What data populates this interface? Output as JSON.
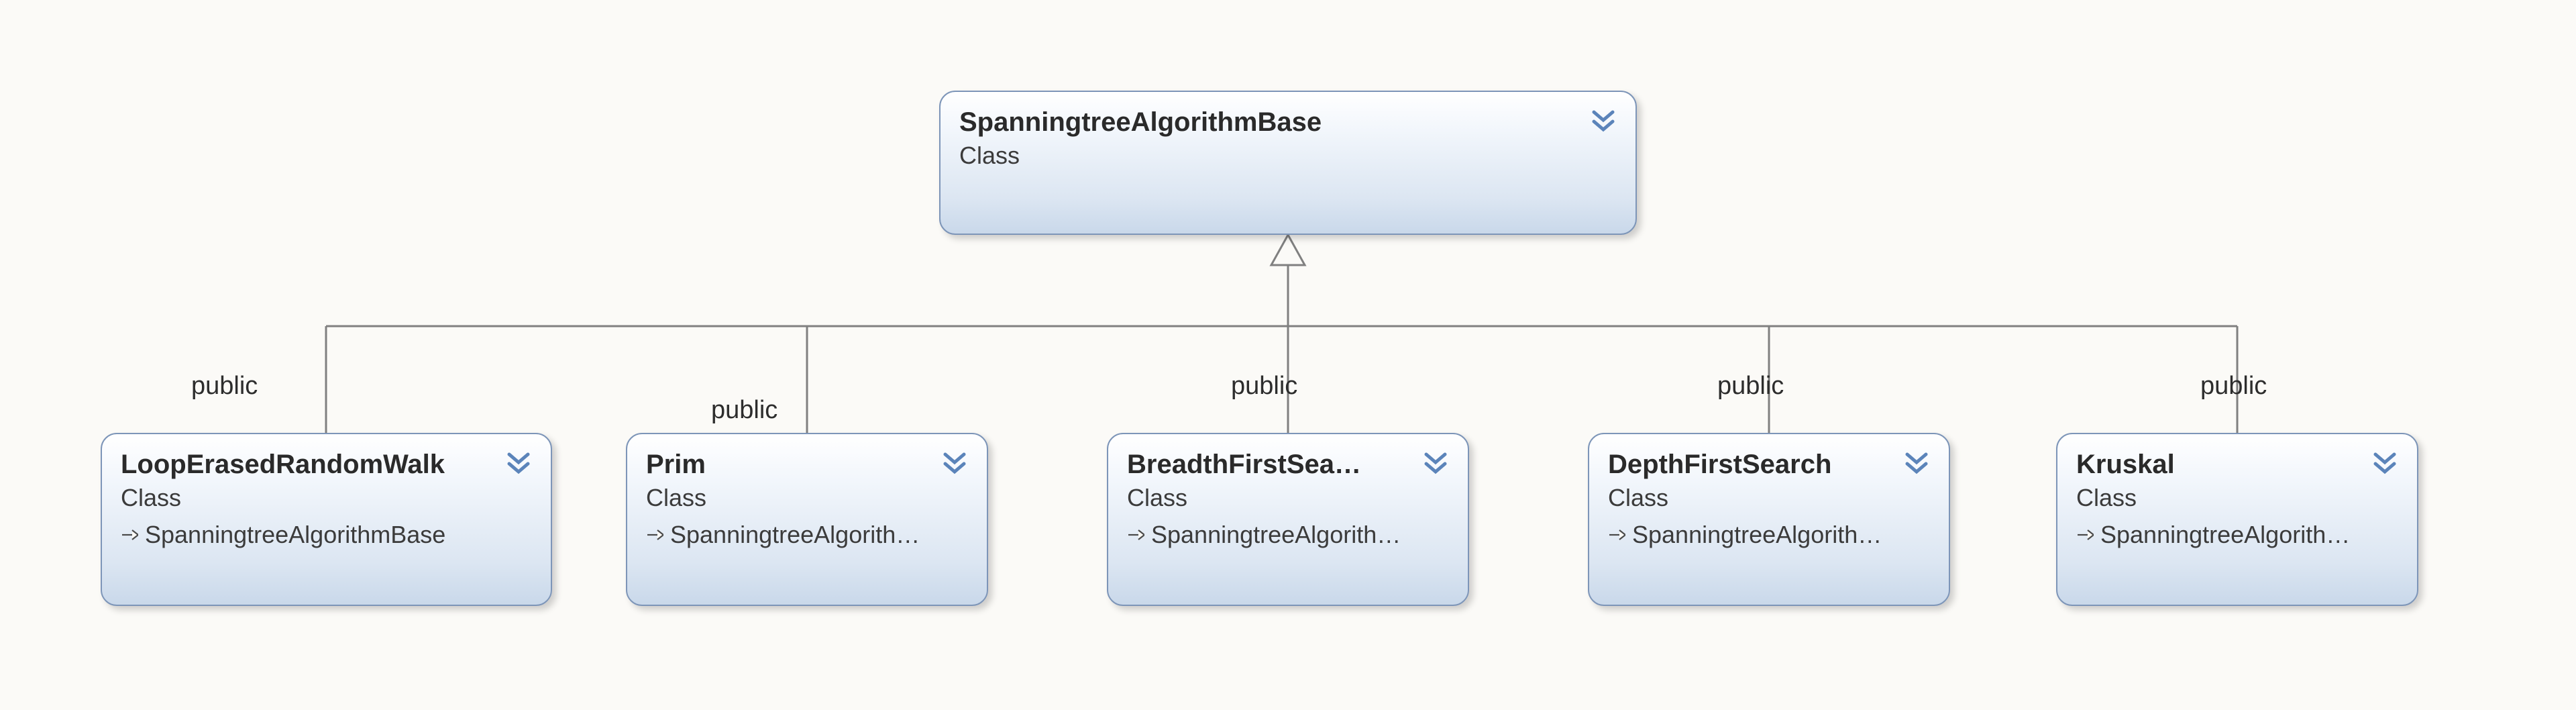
{
  "diagram": {
    "base": {
      "name": "SpanningtreeAlgorithmBase",
      "stereotype": "Class"
    },
    "visibility_label": "public",
    "children": [
      {
        "id": "looperased",
        "name": "LoopErasedRandomWalk",
        "stereotype": "Class",
        "inherits": "SpanningtreeAlgorithmBase"
      },
      {
        "id": "prim",
        "name": "Prim",
        "stereotype": "Class",
        "inherits": "SpanningtreeAlgorith…"
      },
      {
        "id": "bfs",
        "name": "BreadthFirstSea…",
        "stereotype": "Class",
        "inherits": "SpanningtreeAlgorith…"
      },
      {
        "id": "dfs",
        "name": "DepthFirstSearch",
        "stereotype": "Class",
        "inherits": "SpanningtreeAlgorith…"
      },
      {
        "id": "kruskal",
        "name": "Kruskal",
        "stereotype": "Class",
        "inherits": "SpanningtreeAlgorith…"
      }
    ],
    "colors": {
      "box_border": "#7d95b8",
      "box_gradient_top": "#ffffff",
      "box_gradient_bottom": "#c9d8ea",
      "connector": "#808080",
      "chevron": "#5b84ba"
    },
    "expand_icon": "double-chevron-down"
  }
}
